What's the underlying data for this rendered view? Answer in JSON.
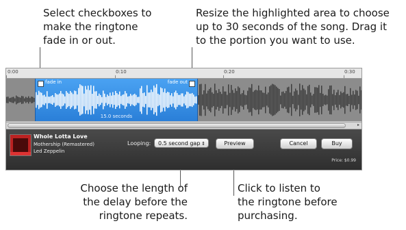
{
  "callouts": {
    "top_left": "Select checkboxes to\nmake the ringtone\nfade in or out.",
    "top_right": "Resize the highlighted area to choose\nup to 30 seconds of the song. Drag it\nto the portion you want to use.",
    "bottom_left": "Choose the length of\nthe delay before the\nringtone repeats.",
    "bottom_right": "Click to listen to\nthe ringtone before\npurchasing."
  },
  "ruler": {
    "ticks": [
      "0:00",
      "0:10",
      "0:20",
      "0:30"
    ]
  },
  "selection": {
    "fade_in_label": "fade in",
    "fade_out_label": "fade out",
    "duration": "15.0 seconds"
  },
  "song": {
    "title": "Whole Lotta Love",
    "album": "Mothership (Remastered)",
    "artist": "Led Zeppelin"
  },
  "controls": {
    "looping_label": "Looping:",
    "looping_value": "0.5 second gap",
    "preview_label": "Preview",
    "cancel_label": "Cancel",
    "buy_label": "Buy",
    "price": "Price: $0.99"
  },
  "icons": {
    "checkbox": "checkbox-icon",
    "select_arrows": "updown-arrows-icon",
    "scroll_right": "triangle-right-icon"
  },
  "colors": {
    "selection_blue": "#2f86e0",
    "panel_dark": "#3a3a3a"
  }
}
